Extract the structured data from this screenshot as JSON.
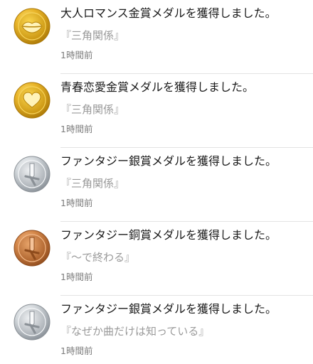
{
  "notifications": [
    {
      "medal": "gold",
      "icon": "lips-icon",
      "title": "大人ロマンス金賞メダルを獲得しました。",
      "subtitle": "『三角関係』",
      "time": "1時間前"
    },
    {
      "medal": "gold",
      "icon": "heart-icon",
      "title": "青春恋愛金賞メダルを獲得しました。",
      "subtitle": "『三角関係』",
      "time": "1時間前"
    },
    {
      "medal": "silver",
      "icon": "sword-icon",
      "title": "ファンタジー銀賞メダルを獲得しました。",
      "subtitle": "『三角関係』",
      "time": "1時間前"
    },
    {
      "medal": "bronze",
      "icon": "sword-icon",
      "title": "ファンタジー銅賞メダルを獲得しました。",
      "subtitle": "『～で終わる』",
      "time": "1時間前"
    },
    {
      "medal": "silver",
      "icon": "sword-icon",
      "title": "ファンタジー銀賞メダルを獲得しました。",
      "subtitle": "『なぜか曲だけは知っている』",
      "time": "1時間前"
    }
  ],
  "colors": {
    "gold": "#d9a514",
    "silver": "#b9bfc5",
    "bronze": "#c67a3c"
  }
}
